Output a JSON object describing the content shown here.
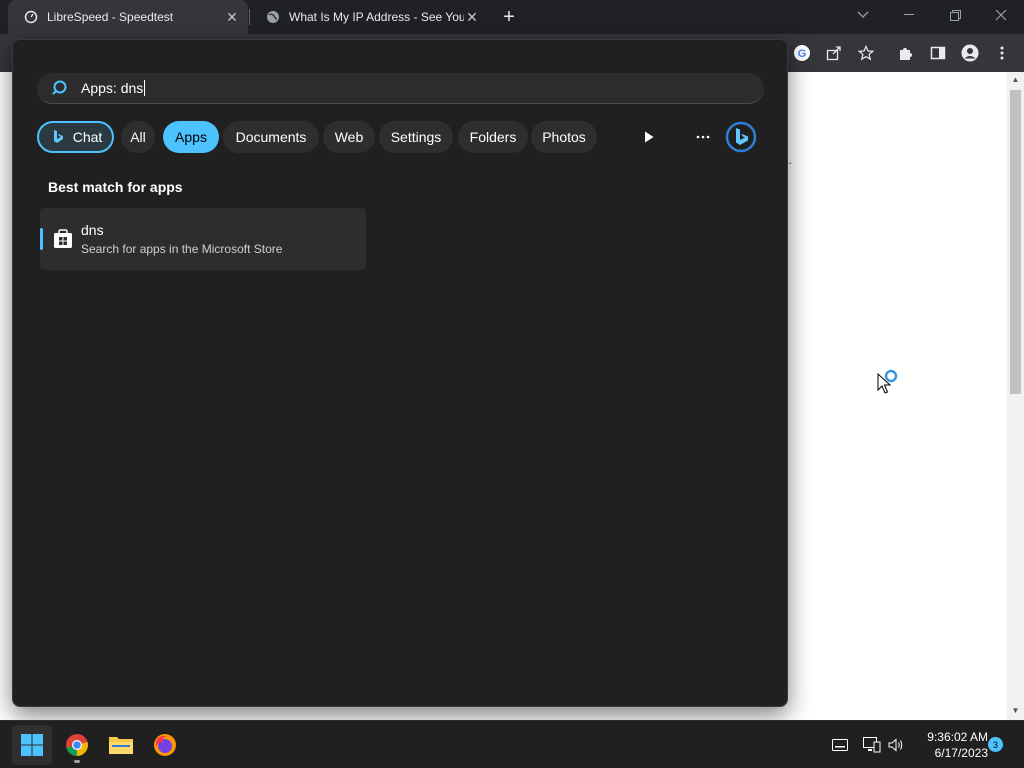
{
  "browser": {
    "tabs": [
      {
        "title": "LibreSpeed - Speedtest",
        "active": true
      },
      {
        "title": "What Is My IP Address - See Your",
        "active": false
      }
    ],
    "page_fragment": "t."
  },
  "search": {
    "query": "Apps: dns",
    "filters": [
      {
        "label": "Chat",
        "selected": false
      },
      {
        "label": "All",
        "selected": false
      },
      {
        "label": "Apps",
        "selected": true
      },
      {
        "label": "Documents",
        "selected": false
      },
      {
        "label": "Web",
        "selected": false
      },
      {
        "label": "Settings",
        "selected": false
      },
      {
        "label": "Folders",
        "selected": false
      },
      {
        "label": "Photos",
        "selected": false
      }
    ],
    "section_title": "Best match for apps",
    "result": {
      "name": "dns",
      "subtitle": "Search for apps in the Microsoft Store",
      "icon": "microsoft-store-icon"
    }
  },
  "taskbar": {
    "apps": [
      "windows-start-icon",
      "chrome-icon",
      "file-explorer-icon",
      "firefox-icon"
    ],
    "time": "9:36:02 AM",
    "date": "6/17/2023",
    "notification_count": "3"
  },
  "colors": {
    "accent": "#4cc2ff",
    "panel_bg": "#202020",
    "chip_bg": "#2e2e2e"
  }
}
